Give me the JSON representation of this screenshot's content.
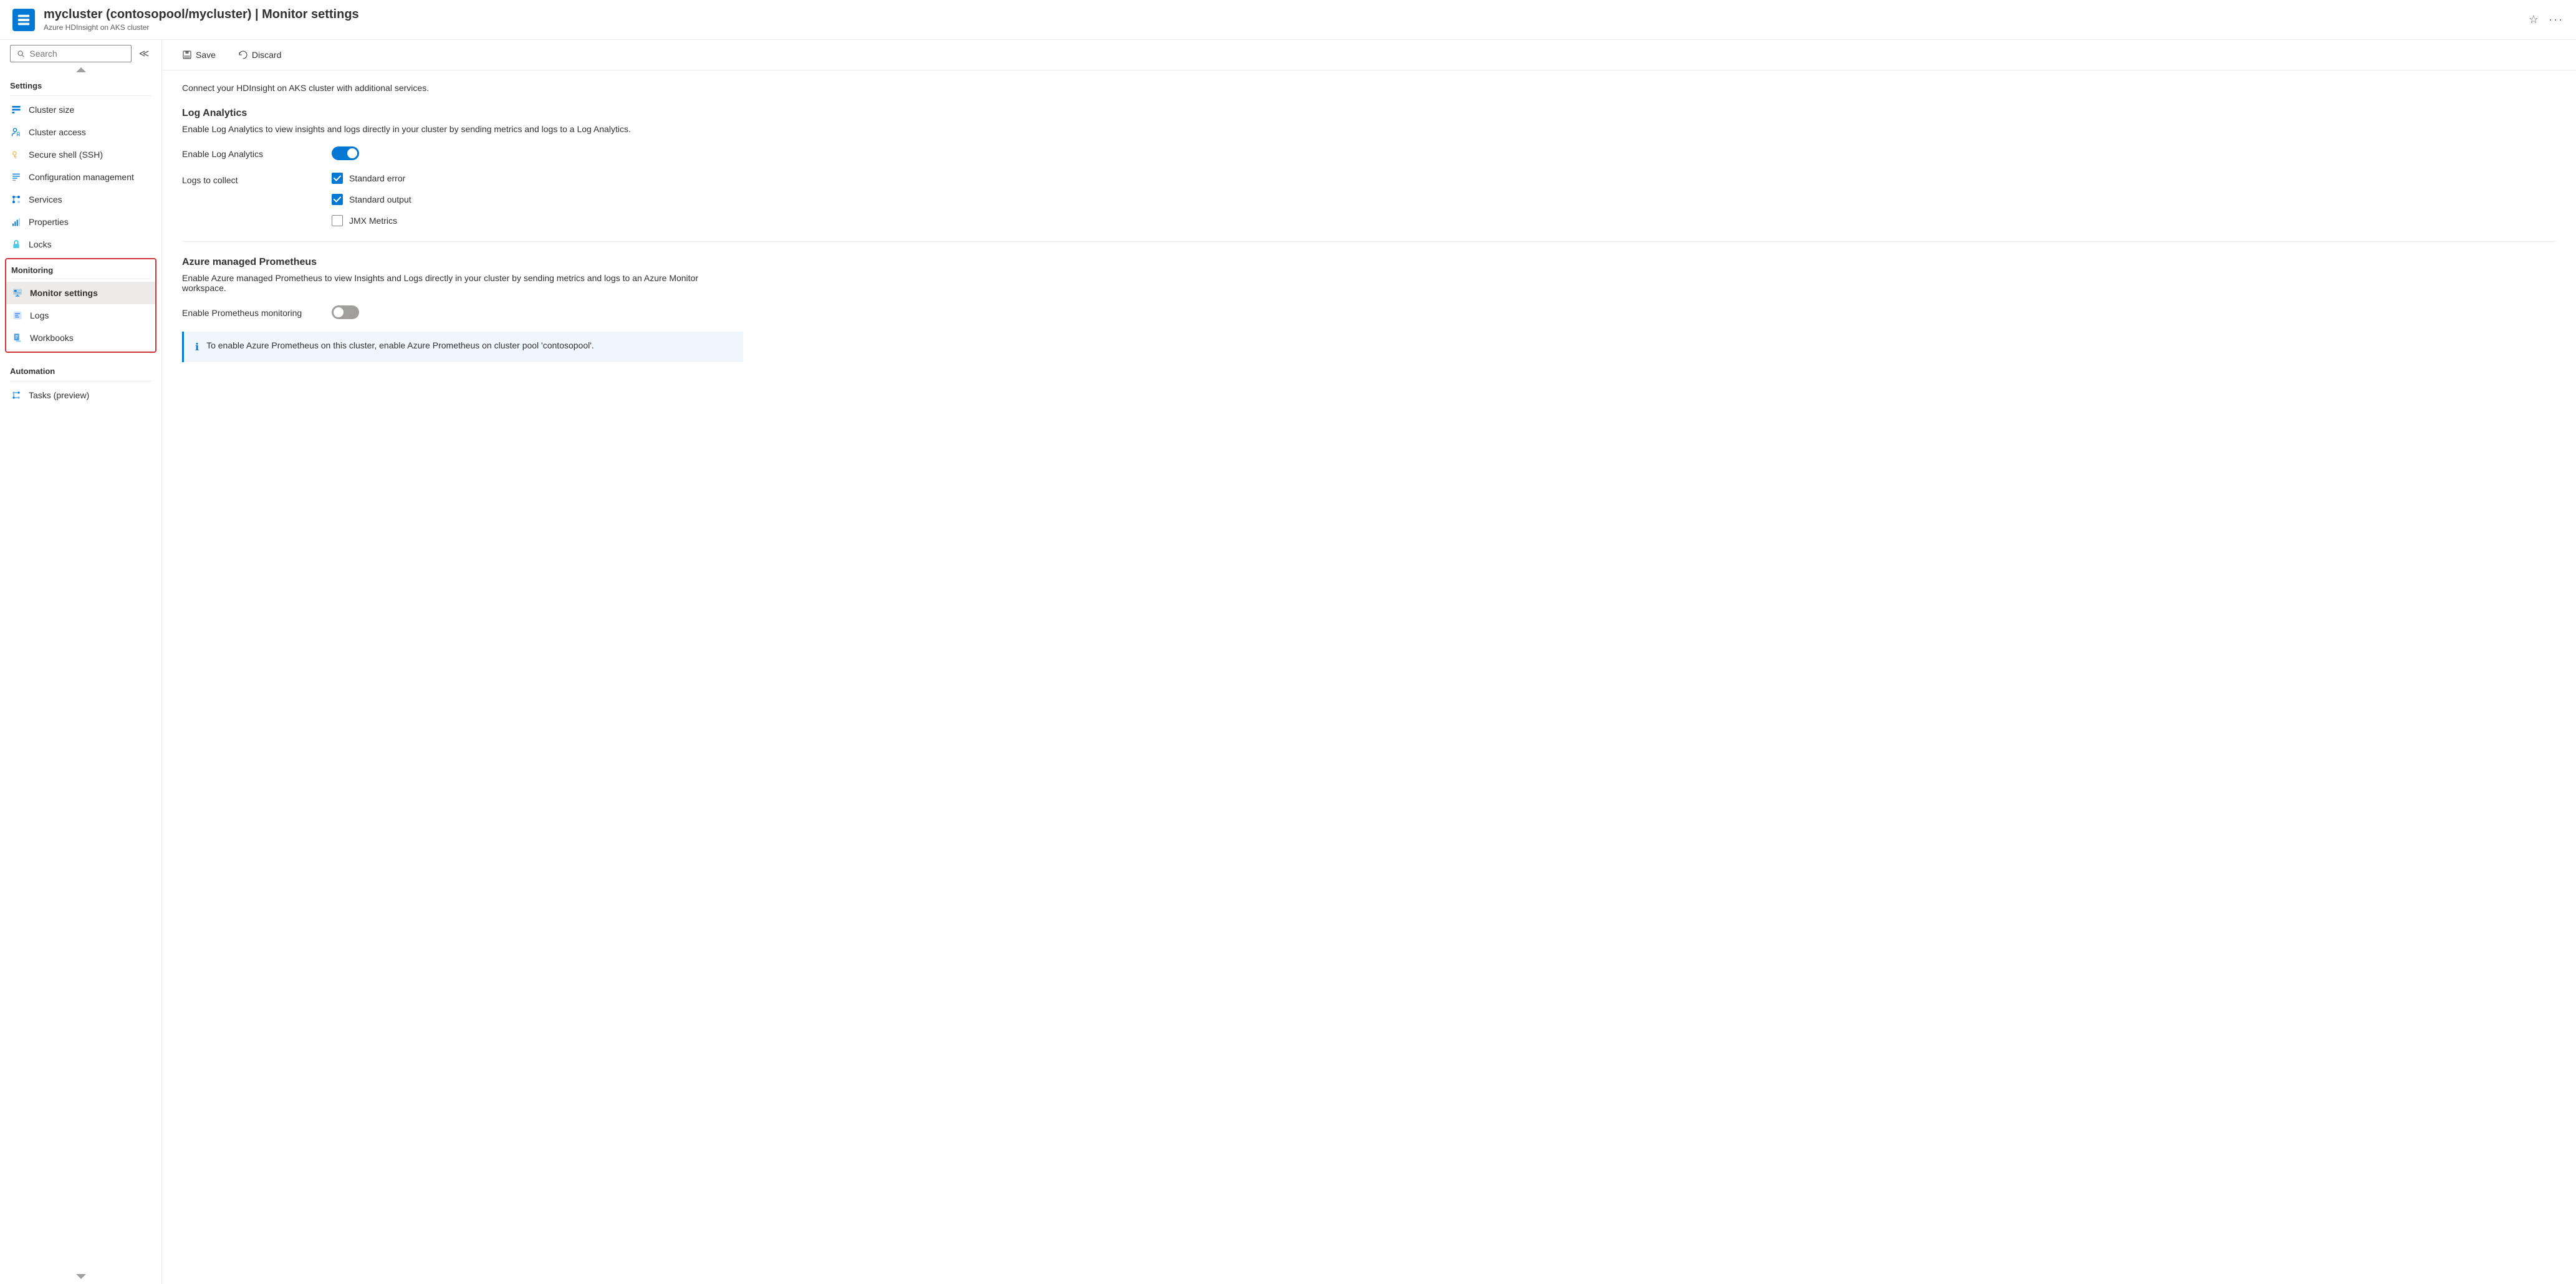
{
  "header": {
    "title": "mycluster (contosopool/mycluster) | Monitor settings",
    "subtitle": "Azure HDInsight on AKS cluster"
  },
  "search": {
    "placeholder": "Search"
  },
  "toolbar": {
    "save_label": "Save",
    "discard_label": "Discard"
  },
  "content": {
    "description": "Connect your HDInsight on AKS cluster with additional services.",
    "log_analytics": {
      "title": "Log Analytics",
      "description": "Enable Log Analytics to view insights and logs directly in your cluster by sending metrics and logs to a Log Analytics.",
      "enable_label": "Enable Log Analytics",
      "enable_state": "on",
      "logs_to_collect_label": "Logs to collect",
      "checkboxes": [
        {
          "id": "std_error",
          "label": "Standard error",
          "checked": true
        },
        {
          "id": "std_output",
          "label": "Standard output",
          "checked": true
        },
        {
          "id": "jmx_metrics",
          "label": "JMX Metrics",
          "checked": false
        }
      ]
    },
    "azure_prometheus": {
      "title": "Azure managed Prometheus",
      "description": "Enable Azure managed Prometheus to view Insights and Logs directly in your cluster by sending metrics and logs to an Azure Monitor workspace.",
      "enable_label": "Enable Prometheus monitoring",
      "enable_state": "off",
      "info_text": "To enable Azure Prometheus on this cluster, enable Azure Prometheus on cluster pool 'contosopool'."
    }
  },
  "sidebar": {
    "settings_label": "Settings",
    "settings_items": [
      {
        "id": "cluster-size",
        "label": "Cluster size",
        "icon": "table-icon"
      },
      {
        "id": "cluster-access",
        "label": "Cluster access",
        "icon": "people-icon"
      },
      {
        "id": "secure-shell",
        "label": "Secure shell (SSH)",
        "icon": "key-icon"
      },
      {
        "id": "configuration-management",
        "label": "Configuration management",
        "icon": "list-icon"
      },
      {
        "id": "services",
        "label": "Services",
        "icon": "services-icon"
      },
      {
        "id": "properties",
        "label": "Properties",
        "icon": "bar-chart-icon"
      },
      {
        "id": "locks",
        "label": "Locks",
        "icon": "lock-icon"
      }
    ],
    "monitoring_label": "Monitoring",
    "monitoring_items": [
      {
        "id": "monitor-settings",
        "label": "Monitor settings",
        "icon": "monitor-icon",
        "active": true
      },
      {
        "id": "logs",
        "label": "Logs",
        "icon": "logs-icon"
      },
      {
        "id": "workbooks",
        "label": "Workbooks",
        "icon": "workbooks-icon"
      }
    ],
    "automation_label": "Automation",
    "automation_items": [
      {
        "id": "tasks-preview",
        "label": "Tasks (preview)",
        "icon": "tasks-icon"
      }
    ]
  }
}
